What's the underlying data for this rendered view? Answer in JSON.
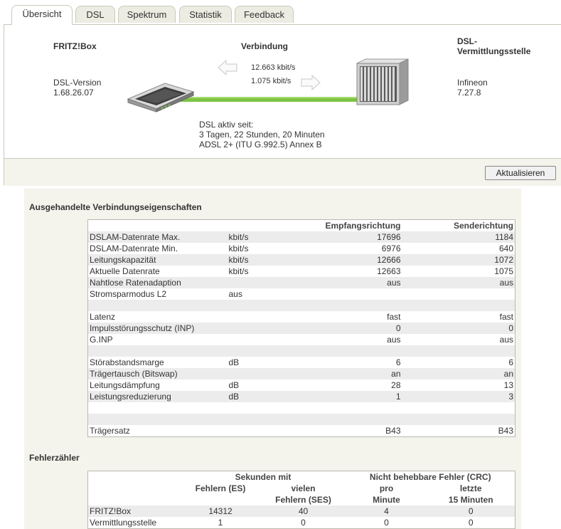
{
  "tabs": [
    {
      "label": "Übersicht",
      "active": true
    },
    {
      "label": "DSL",
      "active": false
    },
    {
      "label": "Spektrum",
      "active": false
    },
    {
      "label": "Statistik",
      "active": false
    },
    {
      "label": "Feedback",
      "active": false
    }
  ],
  "overview": {
    "fritzbox_title": "FRITZ!Box",
    "dsl_version_label": "DSL-Version",
    "dsl_version_value": "1.68.26.07",
    "connection_title": "Verbindung",
    "downstream_rate": "12.663 kbit/s",
    "upstream_rate": "1.075 kbit/s",
    "exchange_title_line1": "DSL-",
    "exchange_title_line2": "Vermittlungsstelle",
    "exchange_vendor": "Infineon",
    "exchange_version": "7.27.8",
    "active_since_label": "DSL aktiv seit:",
    "active_since_value": "3 Tagen, 22 Stunden, 20 Minuten",
    "mode": "ADSL 2+ (ITU G.992.5) Annex B",
    "line_color": "#7dc443",
    "refresh_button": "Aktualisieren"
  },
  "properties": {
    "title": "Ausgehandelte Verbindungseigenschaften",
    "headers": {
      "receive": "Empfangsrichtung",
      "send": "Senderichtung"
    },
    "rows": [
      {
        "name": "DSLAM-Datenrate Max.",
        "unit": "kbit/s",
        "rx": "17696",
        "tx": "1184"
      },
      {
        "name": "DSLAM-Datenrate Min.",
        "unit": "kbit/s",
        "rx": "6976",
        "tx": "640"
      },
      {
        "name": "Leitungskapazität",
        "unit": "kbit/s",
        "rx": "12666",
        "tx": "1072"
      },
      {
        "name": "Aktuelle Datenrate",
        "unit": "kbit/s",
        "rx": "12663",
        "tx": "1075"
      },
      {
        "name": "Nahtlose Ratenadaption",
        "unit": "",
        "rx": "aus",
        "tx": "aus"
      },
      {
        "name": "Stromsparmodus L2",
        "unit": "aus",
        "rx": "",
        "tx": ""
      },
      {
        "name": "",
        "unit": "",
        "rx": "",
        "tx": ""
      },
      {
        "name": "Latenz",
        "unit": "",
        "rx": "fast",
        "tx": "fast"
      },
      {
        "name": "Impulsstörungsschutz (INP)",
        "unit": "",
        "rx": "0",
        "tx": "0"
      },
      {
        "name": "G.INP",
        "unit": "",
        "rx": "aus",
        "tx": "aus"
      },
      {
        "name": "",
        "unit": "",
        "rx": "",
        "tx": ""
      },
      {
        "name": "Störabstandsmarge",
        "unit": "dB",
        "rx": "6",
        "tx": "6"
      },
      {
        "name": "Trägertausch (Bitswap)",
        "unit": "",
        "rx": "an",
        "tx": "an"
      },
      {
        "name": "Leitungsdämpfung",
        "unit": "dB",
        "rx": "28",
        "tx": "13"
      },
      {
        "name": "Leistungsreduzierung",
        "unit": "dB",
        "rx": "1",
        "tx": "3"
      },
      {
        "name": "",
        "unit": "",
        "rx": "",
        "tx": ""
      },
      {
        "name": "",
        "unit": "",
        "rx": "",
        "tx": ""
      },
      {
        "name": "Trägersatz",
        "unit": "",
        "rx": "B43",
        "tx": "B43"
      }
    ]
  },
  "errors": {
    "title": "Fehlerzähler",
    "group_seconds": "Sekunden mit",
    "group_crc": "Nicht behebbare Fehler (CRC)",
    "col_es": "Fehlern (ES)",
    "col_ses_line1": "vielen",
    "col_ses_line2": "Fehlern (SES)",
    "col_min_line1": "pro",
    "col_min_line2": "Minute",
    "col_15_line1": "letzte",
    "col_15_line2": "15 Minuten",
    "rows": [
      {
        "name": "FRITZ!Box",
        "es": "14312",
        "ses": "40",
        "min": "4",
        "m15": "0"
      },
      {
        "name": "Vermittlungsstelle",
        "es": "1",
        "ses": "0",
        "min": "0",
        "m15": "0"
      }
    ]
  }
}
